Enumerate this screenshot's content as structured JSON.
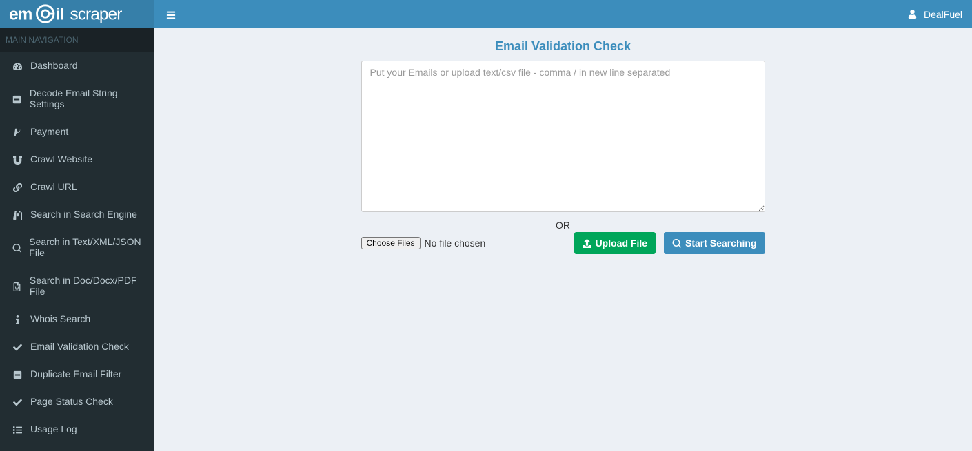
{
  "brand": {
    "name": "email scraper"
  },
  "topbar": {
    "username": "DealFuel"
  },
  "sidebar": {
    "header": "MAIN NAVIGATION",
    "items": [
      {
        "id": "dashboard",
        "label": "Dashboard",
        "icon": "dashboard"
      },
      {
        "id": "decode-email",
        "label": "Decode Email String Settings",
        "icon": "minus-square"
      },
      {
        "id": "payment",
        "label": "Payment",
        "icon": "paypal"
      },
      {
        "id": "crawl-website",
        "label": "Crawl Website",
        "icon": "magnet"
      },
      {
        "id": "crawl-url",
        "label": "Crawl URL",
        "icon": "link"
      },
      {
        "id": "search-engine",
        "label": "Search in Search Engine",
        "icon": "binoculars"
      },
      {
        "id": "search-text",
        "label": "Search in Text/XML/JSON File",
        "icon": "search"
      },
      {
        "id": "search-doc",
        "label": "Search in Doc/Docx/PDF File",
        "icon": "file-word"
      },
      {
        "id": "whois",
        "label": "Whois Search",
        "icon": "info"
      },
      {
        "id": "email-validation",
        "label": "Email Validation Check",
        "icon": "check"
      },
      {
        "id": "duplicate-filter",
        "label": "Duplicate Email Filter",
        "icon": "minus-square"
      },
      {
        "id": "page-status",
        "label": "Page Status Check",
        "icon": "check"
      },
      {
        "id": "usage-log",
        "label": "Usage Log",
        "icon": "list"
      }
    ]
  },
  "main": {
    "title": "Email Validation Check",
    "textarea_placeholder": "Put your Emails or upload text/csv file - comma / in new line separated",
    "textarea_value": "",
    "or_label": "OR",
    "choose_files_label": "Choose Files",
    "file_status": "No file chosen",
    "upload_label": "Upload File",
    "start_label": "Start Searching"
  }
}
